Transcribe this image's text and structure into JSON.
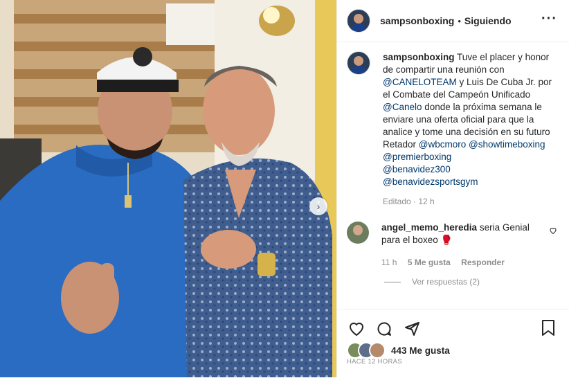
{
  "post": {
    "username": "sampsonboxing",
    "separator": "•",
    "follow_status": "Siguiendo",
    "more_icon": "more-horizontal-icon"
  },
  "caption": {
    "username": "sampsonboxing",
    "text_1": " Tuve el placer y honor de compartir una reunión con ",
    "mention_1": "@CANELOTEAM",
    "text_2": " y Luis De Cuba Jr. por el Combate del Campeón Unificado ",
    "mention_2": "@Canelo",
    "text_3": " donde la próxima semana le enviare una oferta oficial para que la analice y tome una decisión en su futuro Retador ",
    "mention_3": "@wbcmoro",
    "mention_4": "@showtimeboxing",
    "mention_5": "@premierboxing",
    "mention_6": "@benavidez300",
    "mention_7": "@benavidezsportsgym",
    "edited": "Editado · 12 h"
  },
  "comment": {
    "username": "angel_memo_heredia",
    "text": " seria Genial para el boxeo 🥊",
    "time": "11 h",
    "likes": "5 Me gusta",
    "reply": "Responder",
    "view_replies": "Ver respuestas (2)"
  },
  "footer": {
    "likes_text": "443 Me gusta",
    "timestamp": "HACE 12 HORAS"
  },
  "colors": {
    "link": "#00376b",
    "muted": "#8e8e8e",
    "text": "#262626",
    "border": "#efefef"
  }
}
